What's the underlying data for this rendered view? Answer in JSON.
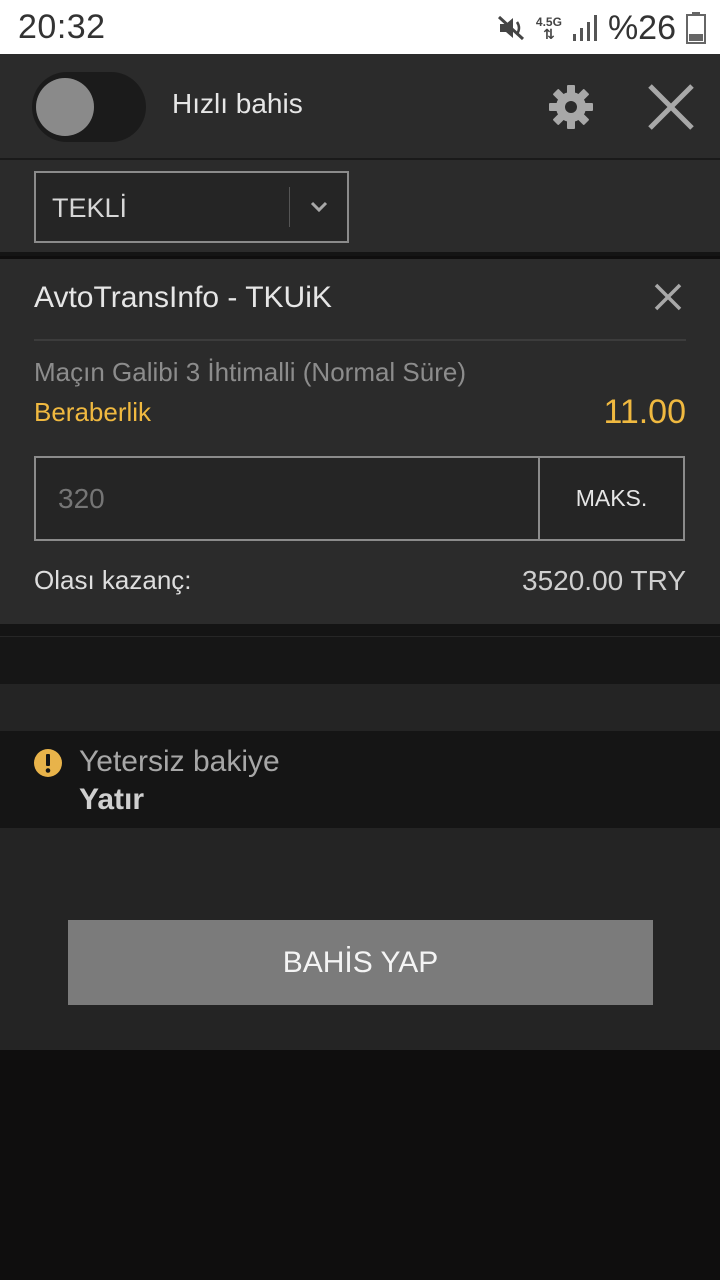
{
  "status_bar": {
    "time": "20:32",
    "network": "4.5G",
    "battery": "%26",
    "icons": [
      "mute-icon",
      "network-arrows-icon",
      "signal-icon",
      "battery-icon"
    ]
  },
  "top_bar": {
    "quick_bet_label": "Hızlı bahis",
    "quick_bet_enabled": false
  },
  "bet_type": {
    "selected": "TEKLİ"
  },
  "bet": {
    "match": "AvtoTransInfo - TKUiK",
    "market": "Maçın Galibi 3 İhtimalli (Normal Süre)",
    "selection": "Beraberlik",
    "odds": "11.00",
    "stake_placeholder": "320",
    "max_label": "MAKS.",
    "potential_win_label": "Olası kazanç:",
    "potential_win_value": "3520.00 TRY"
  },
  "warning": {
    "message": "Yetersiz bakiye",
    "action": "Yatır"
  },
  "place_bet": {
    "label": "BAHİS YAP"
  },
  "colors": {
    "accent": "#f0b940",
    "panel": "#2b2b2b",
    "background": "#0f0e0e",
    "button": "#7b7b7b"
  }
}
